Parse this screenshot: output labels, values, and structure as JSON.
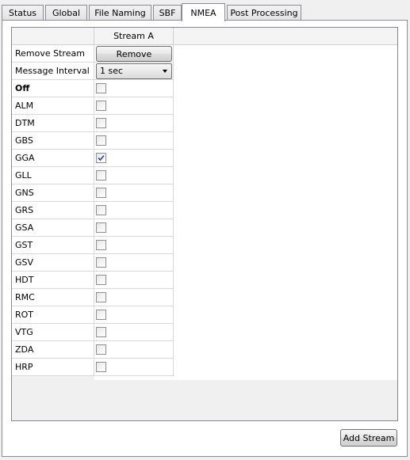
{
  "tabs": [
    {
      "label": "Status",
      "active": false
    },
    {
      "label": "Global",
      "active": false
    },
    {
      "label": "File Naming",
      "active": false
    },
    {
      "label": "SBF",
      "active": false
    },
    {
      "label": "NMEA",
      "active": true
    },
    {
      "label": "Post Processing",
      "active": false
    }
  ],
  "grid": {
    "column_header": "Stream A",
    "remove_row": {
      "label": "Remove Stream",
      "button_label": "Remove"
    },
    "interval_row": {
      "label": "Message Interval",
      "selected": "1 sec"
    },
    "messages": [
      {
        "label": "Off",
        "checked": false,
        "bold": true
      },
      {
        "label": "ALM",
        "checked": false
      },
      {
        "label": "DTM",
        "checked": false
      },
      {
        "label": "GBS",
        "checked": false
      },
      {
        "label": "GGA",
        "checked": true
      },
      {
        "label": "GLL",
        "checked": false
      },
      {
        "label": "GNS",
        "checked": false
      },
      {
        "label": "GRS",
        "checked": false
      },
      {
        "label": "GSA",
        "checked": false
      },
      {
        "label": "GST",
        "checked": false
      },
      {
        "label": "GSV",
        "checked": false
      },
      {
        "label": "HDT",
        "checked": false
      },
      {
        "label": "RMC",
        "checked": false
      },
      {
        "label": "ROT",
        "checked": false
      },
      {
        "label": "VTG",
        "checked": false
      },
      {
        "label": "ZDA",
        "checked": false
      },
      {
        "label": "HRP",
        "checked": false
      }
    ]
  },
  "footer": {
    "add_stream_label": "Add Stream"
  }
}
